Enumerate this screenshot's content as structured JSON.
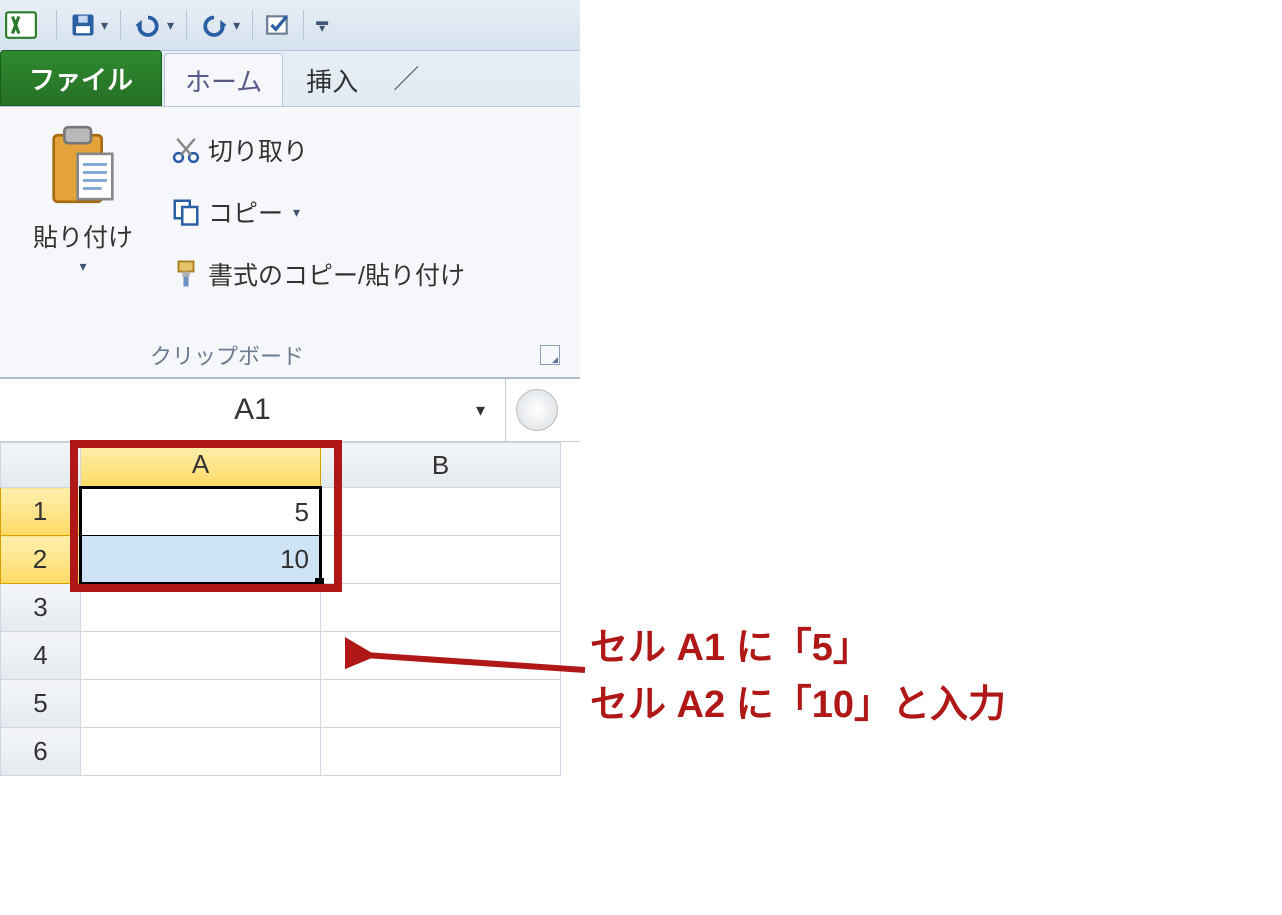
{
  "qat": {
    "save_tooltip": "保存",
    "undo_tooltip": "元に戻す",
    "redo_tooltip": "やり直し",
    "check_tooltip": "チェック"
  },
  "tabs": {
    "file": "ファイル",
    "home": "ホーム",
    "insert": "挿入",
    "truncated": "／"
  },
  "clipboard": {
    "paste": "貼り付け",
    "cut": "切り取り",
    "copy": "コピー",
    "format_painter": "書式のコピー/貼り付け",
    "group_label": "クリップボード"
  },
  "namebox": {
    "value": "A1"
  },
  "columns": [
    "A",
    "B"
  ],
  "rows": [
    "1",
    "2",
    "3",
    "4",
    "5",
    "6"
  ],
  "cells": {
    "A1": "5",
    "A2": "10"
  },
  "annotation": {
    "line1": "セル A1 に「5」",
    "line2": "セル A2 に「10」と入力"
  }
}
